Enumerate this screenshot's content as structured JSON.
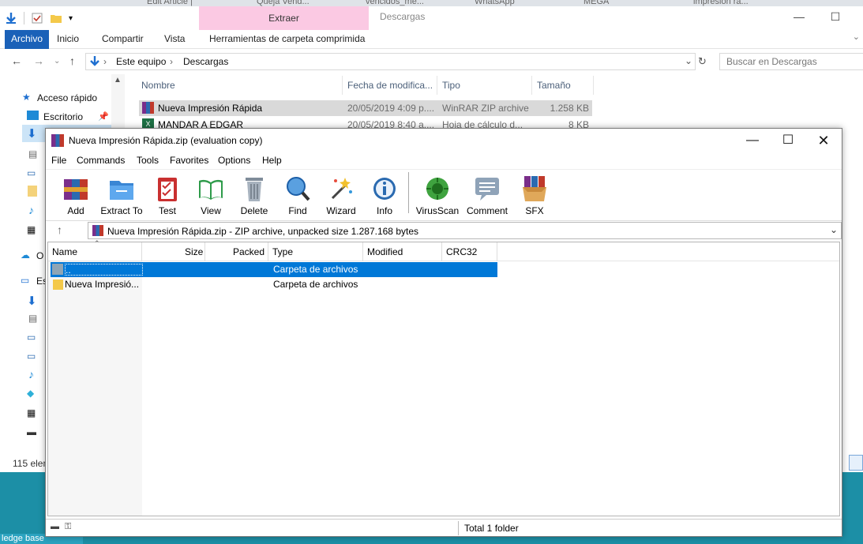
{
  "browser_tabs": [
    "Edit Article |",
    "Queja Vend...",
    "vencidos_me...",
    "WhatsApp",
    "MEGA",
    "impresión rá..."
  ],
  "explorer": {
    "window_title": "Descargas",
    "context_tab": "Extraer",
    "ribbon_tabs": [
      "Archivo",
      "Inicio",
      "Compartir",
      "Vista",
      "Herramientas de carpeta comprimida"
    ],
    "breadcrumb": [
      "Este equipo",
      "Descargas"
    ],
    "search_placeholder": "Buscar en Descargas",
    "nav_items": [
      "Acceso rápido",
      "Escritorio",
      "O",
      "Es"
    ],
    "columns": [
      "Nombre",
      "Fecha de modifica...",
      "Tipo",
      "Tamaño"
    ],
    "files": [
      {
        "name": "Nueva Impresión Rápida",
        "date": "20/05/2019 4:09 p....",
        "type": "WinRAR ZIP archive",
        "size": "1.258 KB"
      },
      {
        "name": "MANDAR A EDGAR",
        "date": "20/05/2019 8:40 a....",
        "type": "Hoja de cálculo d...",
        "size": "8 KB"
      }
    ],
    "status": "115 elem",
    "taskbar_text": "ledge base"
  },
  "winrar": {
    "title": "Nueva Impresión Rápida.zip (evaluation copy)",
    "menu": [
      "File",
      "Commands",
      "Tools",
      "Favorites",
      "Options",
      "Help"
    ],
    "toolbar": [
      {
        "label": "Add",
        "icon": "add-icon"
      },
      {
        "label": "Extract To",
        "icon": "extract-icon"
      },
      {
        "label": "Test",
        "icon": "test-icon"
      },
      {
        "label": "View",
        "icon": "view-icon"
      },
      {
        "label": "Delete",
        "icon": "delete-icon"
      },
      {
        "label": "Find",
        "icon": "find-icon"
      },
      {
        "label": "Wizard",
        "icon": "wizard-icon"
      },
      {
        "label": "Info",
        "icon": "info-icon"
      },
      {
        "label": "VirusScan",
        "icon": "virusscan-icon"
      },
      {
        "label": "Comment",
        "icon": "comment-icon"
      },
      {
        "label": "SFX",
        "icon": "sfx-icon"
      }
    ],
    "path": "Nueva Impresión Rápida.zip - ZIP archive, unpacked size 1.287.168 bytes",
    "columns": [
      "Name",
      "Size",
      "Packed",
      "Type",
      "Modified",
      "CRC32"
    ],
    "rows": [
      {
        "name": "..",
        "type": "Carpeta de archivos",
        "selected": true
      },
      {
        "name": "Nueva Impresió...",
        "type": "Carpeta de archivos",
        "selected": false
      }
    ],
    "status": "Total 1 folder"
  },
  "colors": {
    "accent": "#0078d7",
    "ribbon_file": "#1a61b8",
    "context_tab": "#fbc9e3",
    "teal_bg": "#1c8fa6"
  }
}
